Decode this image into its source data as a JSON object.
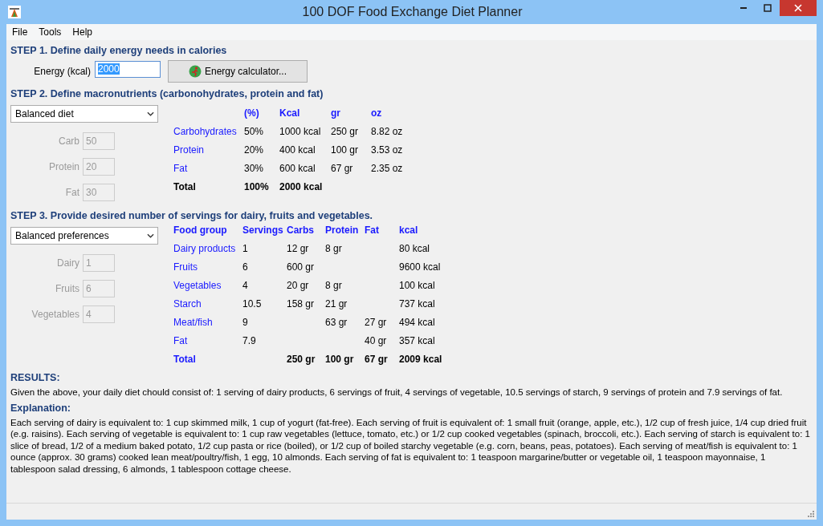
{
  "window": {
    "title": "100 DOF Food Exchange Diet Planner"
  },
  "menu": [
    {
      "label": "File"
    },
    {
      "label": "Tools"
    },
    {
      "label": "Help"
    }
  ],
  "step1": {
    "heading": "STEP 1. Define daily energy needs in calories",
    "energy_label": "Energy (kcal)",
    "energy_value": "2000",
    "calculator_button": "Energy calculator..."
  },
  "step2": {
    "heading": "STEP 2. Define macronutrients (carbonohydrates, protein and fat)",
    "dropdown": "Balanced diet",
    "fields": [
      {
        "label": "Carb",
        "value": "50",
        "disabled": true
      },
      {
        "label": "Protein",
        "value": "20",
        "disabled": true
      },
      {
        "label": "Fat",
        "value": "30",
        "disabled": true
      }
    ],
    "table": {
      "columns": [
        "",
        "(%)",
        "Kcal",
        "gr",
        "oz"
      ],
      "rows": [
        {
          "kind": "item",
          "cells": [
            "Carbohydrates",
            "50%",
            "1000 kcal",
            "250 gr",
            "8.82 oz"
          ]
        },
        {
          "kind": "item",
          "cells": [
            "Protein",
            "20%",
            "400 kcal",
            "100 gr",
            "3.53 oz"
          ]
        },
        {
          "kind": "item",
          "cells": [
            "Fat",
            "30%",
            "600 kcal",
            "67 gr",
            "2.35 oz"
          ]
        },
        {
          "kind": "total",
          "cells": [
            "Total",
            "100%",
            "2000 kcal",
            "",
            ""
          ]
        }
      ]
    }
  },
  "step3": {
    "heading": "STEP 3. Provide desired number of servings for dairy, fruits and vegetables.",
    "dropdown": "Balanced preferences",
    "fields": [
      {
        "label": "Dairy",
        "value": "1",
        "disabled": true
      },
      {
        "label": "Fruits",
        "value": "6",
        "disabled": true
      },
      {
        "label": "Vegetables",
        "value": "4",
        "disabled": true
      }
    ],
    "table": {
      "columns": [
        "Food group",
        "Servings",
        "Carbs",
        "Protein",
        "Fat",
        "kcal"
      ],
      "rows": [
        {
          "kind": "item",
          "cells": [
            "Dairy products",
            "1",
            "12 gr",
            "8 gr",
            "",
            " 80 kcal"
          ]
        },
        {
          "kind": "item",
          "cells": [
            "Fruits",
            "6",
            "600 gr",
            "",
            "",
            " 9600 kcal"
          ]
        },
        {
          "kind": "item",
          "cells": [
            "Vegetables",
            "4",
            "20 gr",
            "8 gr",
            "",
            " 100 kcal"
          ]
        },
        {
          "kind": "item",
          "cells": [
            "Starch",
            "10.5",
            "158 gr",
            "21 gr",
            "",
            " 737 kcal"
          ]
        },
        {
          "kind": "item",
          "cells": [
            "Meat/fish",
            "9",
            "",
            "63 gr",
            "27 gr",
            " 494 kcal"
          ]
        },
        {
          "kind": "item",
          "cells": [
            "Fat",
            "7.9",
            "",
            "",
            "40 gr",
            " 357 kcal"
          ]
        },
        {
          "kind": "total",
          "cells": [
            "Total",
            "",
            "250 gr",
            "100 gr",
            "67 gr",
            "2009 kcal"
          ]
        }
      ]
    }
  },
  "results": {
    "heading": "RESULTS:",
    "text": "Given the above, your daily diet chould consist of: 1 serving of dairy products, 6 servings of fruit, 4 servings of vegetable, 10.5 servings of starch, 9 servings of protein and 7.9 servings of fat."
  },
  "explanation": {
    "heading": "Explanation:",
    "text": "Each serving of dairy is equivalent to: 1 cup skimmed milk, 1 cup of yogurt (fat-free). Each serving of fruit is equivalent of: 1 small fruit (orange, apple, etc.), 1/2 cup of fresh juice, 1/4 cup dried fruit (e.g. raisins). Each serving of vegetable is equivalent to: 1 cup raw vegetables (lettuce, tomato, etc.) or 1/2 cup cooked vegetables (spinach, broccoli, etc.). Each serving of starch is equivalent to: 1 slice of bread, 1/2 of a medium baked potato, 1/2 cup pasta or rice (boiled), or 1/2 cup of boiled starchy vegetable (e.g. corn, beans, peas, potatoes). Each serving of meat/fish is equivalent to: 1 ounce (approx. 30 grams) cooked lean meat/poultry/fish, 1 egg, 10 almonds. Each serving of fat is equivalent to: 1 teaspoon margarine/butter or vegetable oil, 1 teaspoon mayonnaise, 1 tablespoon salad dressing, 6 almonds, 1 tablespoon cottage cheese."
  }
}
